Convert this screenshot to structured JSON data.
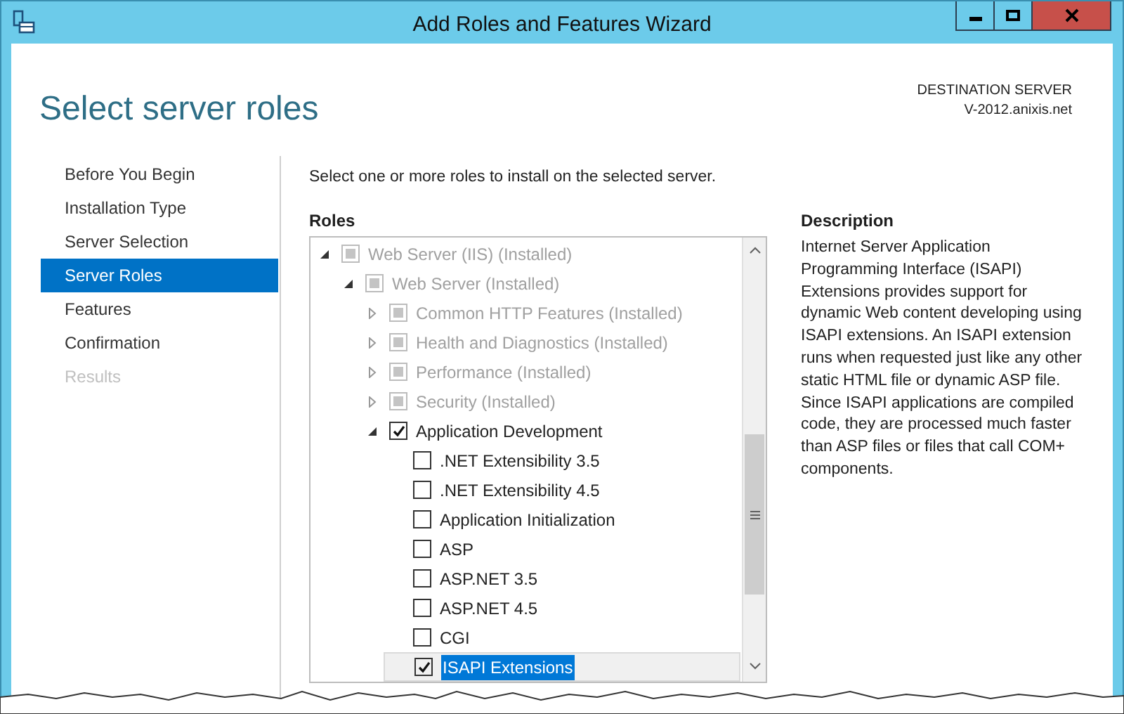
{
  "window": {
    "title": "Add Roles and Features Wizard"
  },
  "page_title": "Select server roles",
  "destination": {
    "label": "DESTINATION SERVER",
    "server": "V-2012.anixis.net"
  },
  "nav": [
    {
      "label": "Before You Begin",
      "selected": false,
      "disabled": false
    },
    {
      "label": "Installation Type",
      "selected": false,
      "disabled": false
    },
    {
      "label": "Server Selection",
      "selected": false,
      "disabled": false
    },
    {
      "label": "Server Roles",
      "selected": true,
      "disabled": false
    },
    {
      "label": "Features",
      "selected": false,
      "disabled": false
    },
    {
      "label": "Confirmation",
      "selected": false,
      "disabled": false
    },
    {
      "label": "Results",
      "selected": false,
      "disabled": true
    }
  ],
  "instruction": "Select one or more roles to install on the selected server.",
  "roles": {
    "heading": "Roles",
    "items": [
      {
        "label": "Web Server (IIS) (Installed)",
        "checked": false,
        "indeterminate": true,
        "disabled": true,
        "expanded": true,
        "selected": false,
        "children": [
          {
            "label": "Web Server (Installed)",
            "checked": false,
            "indeterminate": true,
            "disabled": true,
            "expanded": true,
            "selected": false,
            "children": [
              {
                "label": "Common HTTP Features (Installed)",
                "checked": false,
                "indeterminate": true,
                "disabled": true,
                "expanded": false,
                "selected": false
              },
              {
                "label": "Health and Diagnostics (Installed)",
                "checked": false,
                "indeterminate": true,
                "disabled": true,
                "expanded": false,
                "selected": false
              },
              {
                "label": "Performance (Installed)",
                "checked": false,
                "indeterminate": true,
                "disabled": true,
                "expanded": false,
                "selected": false
              },
              {
                "label": "Security (Installed)",
                "checked": false,
                "indeterminate": true,
                "disabled": true,
                "expanded": false,
                "selected": false
              },
              {
                "label": "Application Development",
                "checked": true,
                "indeterminate": false,
                "disabled": false,
                "expanded": true,
                "selected": false,
                "children": [
                  {
                    "label": ".NET Extensibility 3.5",
                    "checked": false,
                    "indeterminate": false,
                    "disabled": false,
                    "selected": false
                  },
                  {
                    "label": ".NET Extensibility 4.5",
                    "checked": false,
                    "indeterminate": false,
                    "disabled": false,
                    "selected": false
                  },
                  {
                    "label": "Application Initialization",
                    "checked": false,
                    "indeterminate": false,
                    "disabled": false,
                    "selected": false
                  },
                  {
                    "label": "ASP",
                    "checked": false,
                    "indeterminate": false,
                    "disabled": false,
                    "selected": false
                  },
                  {
                    "label": "ASP.NET 3.5",
                    "checked": false,
                    "indeterminate": false,
                    "disabled": false,
                    "selected": false
                  },
                  {
                    "label": "ASP.NET 4.5",
                    "checked": false,
                    "indeterminate": false,
                    "disabled": false,
                    "selected": false
                  },
                  {
                    "label": "CGI",
                    "checked": false,
                    "indeterminate": false,
                    "disabled": false,
                    "selected": false
                  },
                  {
                    "label": "ISAPI Extensions",
                    "checked": true,
                    "indeterminate": false,
                    "disabled": false,
                    "selected": true
                  }
                ]
              }
            ]
          }
        ]
      }
    ]
  },
  "description": {
    "heading": "Description",
    "text": "Internet Server Application Programming Interface (ISAPI) Extensions provides support for dynamic Web content developing using ISAPI extensions. An ISAPI extension runs when requested just like any other static HTML file or dynamic ASP file. Since ISAPI applications are compiled code, they are processed much faster than ASP files or files that call COM+ components."
  }
}
